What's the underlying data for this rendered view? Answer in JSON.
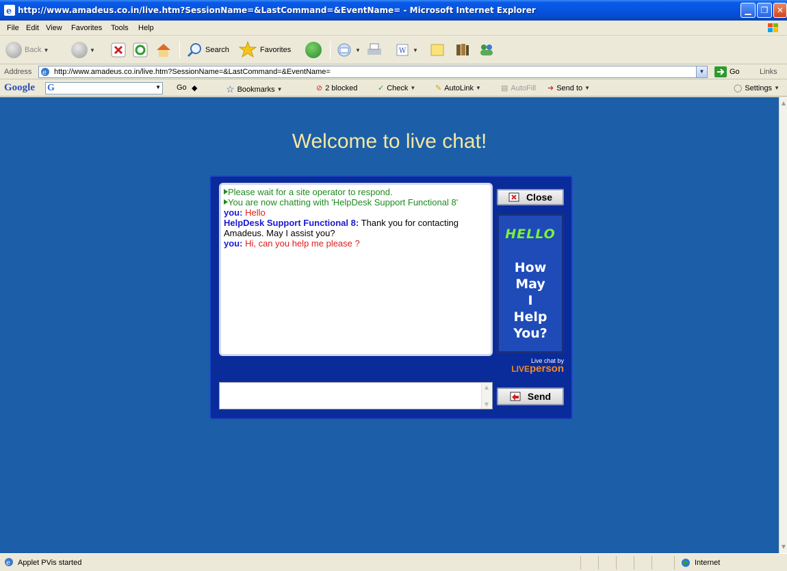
{
  "window": {
    "title": "http://www.amadeus.co.in/live.htm?SessionName=&LastCommand=&EventName= - Microsoft Internet Explorer"
  },
  "menu": [
    "File",
    "Edit",
    "View",
    "Favorites",
    "Tools",
    "Help"
  ],
  "toolbar": {
    "back": "Back",
    "search": "Search",
    "favorites": "Favorites"
  },
  "address": {
    "label": "Address",
    "url": "http://www.amadeus.co.in/live.htm?SessionName=&LastCommand=&EventName=",
    "go": "Go",
    "links": "Links"
  },
  "google": {
    "logo": "Google",
    "go": "Go",
    "bookmarks": "Bookmarks",
    "blocked": "2 blocked",
    "check": "Check",
    "autolink": "AutoLink",
    "autofill": "AutoFill",
    "sendto": "Send to",
    "settings": "Settings"
  },
  "page": {
    "welcome": "Welcome to live chat!"
  },
  "chat": {
    "messages": {
      "sys1": "Please wait for a site operator to respond.",
      "sys2": "You are now chatting with 'HelpDesk Support Functional 8'",
      "you1_who": "you:",
      "you1_text": "Hello",
      "op1_who": "HelpDesk Support Functional 8:",
      "op1_text": "Thank you for contacting Amadeus. May I assist you?",
      "you2_who": "you:",
      "you2_text": "Hi, can you help me please ?"
    },
    "close_label": "Close",
    "send_label": "Send",
    "input_value": ""
  },
  "panel": {
    "hello": "HELLO",
    "how": "How",
    "may": "May",
    "i": "I",
    "help": "Help",
    "you": "You?"
  },
  "liveperson": {
    "by": "Live chat by",
    "brand_live": "LIVE",
    "brand_person": "person"
  },
  "status": {
    "text": "Applet PVis started",
    "zone": "Internet"
  },
  "colors": {
    "page_bg": "#1c5fa8",
    "welcome_text": "#f6e7a0",
    "system_msg": "#1e8a1e",
    "user_name": "#1a1ad0",
    "user_msg": "#e01a1a",
    "hello_text": "#7cf03a",
    "brand": "#f08a2a"
  }
}
